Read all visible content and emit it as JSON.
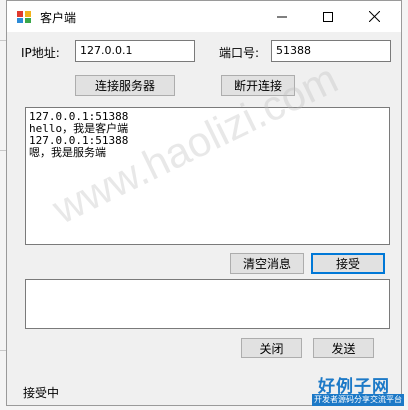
{
  "window": {
    "title": "客户端"
  },
  "form": {
    "ip_label": "IP地址:",
    "ip_value": "127.0.0.1",
    "port_label": "端口号:",
    "port_value": "51388"
  },
  "buttons": {
    "connect": "连接服务器",
    "disconnect": "断开连接",
    "clear": "清空消息",
    "receive": "接受",
    "close": "关闭",
    "send": "发送"
  },
  "messages": [
    "127.0.0.1:51388",
    "hello，我是客户端",
    "127.0.0.1:51388",
    "嗯，我是服务端"
  ],
  "input": {
    "value": ""
  },
  "status": {
    "text": "接受中"
  },
  "watermark": {
    "text": "www.haolizi.com"
  },
  "logo": {
    "main": "好例子网",
    "sub": "开发者源码分享交流平台"
  },
  "colors": {
    "accent": "#0078d7",
    "logo_blue": "#1c79c7"
  }
}
